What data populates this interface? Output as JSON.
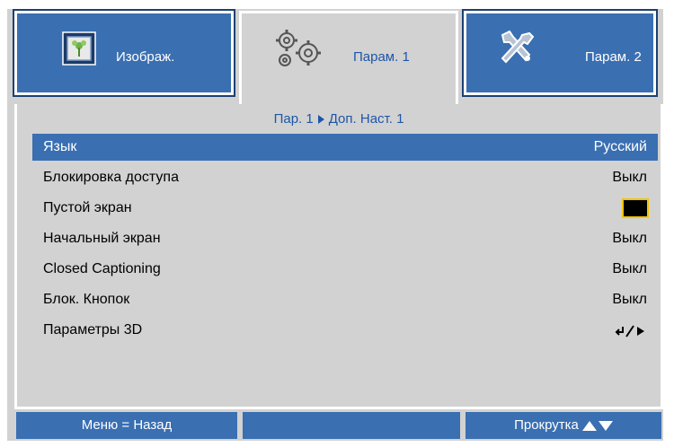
{
  "tabs": [
    {
      "label": "Изображ.",
      "icon": "image-icon",
      "active": false
    },
    {
      "label": "Парам. 1",
      "icon": "gears-icon",
      "active": true
    },
    {
      "label": "Парам. 2",
      "icon": "tools-icon",
      "active": false
    }
  ],
  "breadcrumb": {
    "part1": "Пар. 1",
    "part2": "Доп. Наст. 1"
  },
  "menu": {
    "items": [
      {
        "label": "Язык",
        "value": "Русский",
        "selected": true
      },
      {
        "label": "Блокировка доступа",
        "value": "Выкл"
      },
      {
        "label": "Пустой экран",
        "value_type": "color-swatch",
        "swatch_color": "#000000"
      },
      {
        "label": "Начальный экран",
        "value": "Выкл"
      },
      {
        "label": "Closed Captioning",
        "value": "Выкл"
      },
      {
        "label": "Блок. Кнопок",
        "value": "Выкл"
      },
      {
        "label": "Параметры 3D",
        "value_type": "enter-icon"
      }
    ]
  },
  "footer": {
    "back_label": "Меню = Назад",
    "scroll_label": "Прокрутка"
  },
  "colors": {
    "accent": "#3a6fb2",
    "background": "#d2d2d2",
    "breadcrumb": "#1e56a8"
  }
}
